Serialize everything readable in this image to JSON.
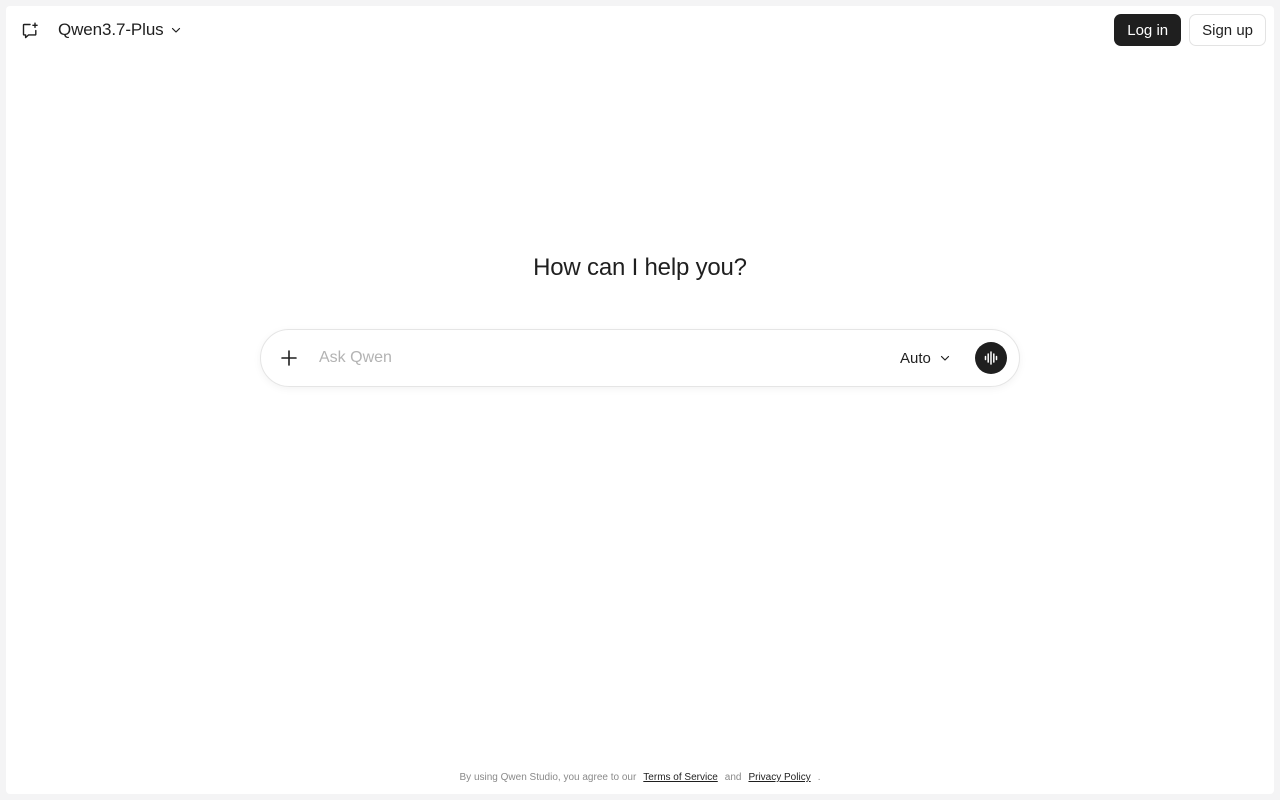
{
  "header": {
    "new_chat_icon": "new-chat-icon",
    "model_name": "Qwen3.7-Plus",
    "login_label": "Log in",
    "signup_label": "Sign up"
  },
  "main": {
    "headline": "How can I help you?",
    "composer": {
      "placeholder": "Ask Qwen",
      "value": "",
      "mode": "Auto"
    }
  },
  "footer": {
    "prefix": "By using Qwen Studio, you agree to our",
    "terms_label": "Terms of Service",
    "and_text": "and",
    "privacy_label": "Privacy Policy",
    "suffix": "."
  },
  "colors": {
    "primary_dark": "#1f1f1f",
    "background": "#ffffff",
    "frame_bg": "#f4f4f5",
    "placeholder": "#b3b3b3",
    "muted_text": "#8a8a8a"
  }
}
